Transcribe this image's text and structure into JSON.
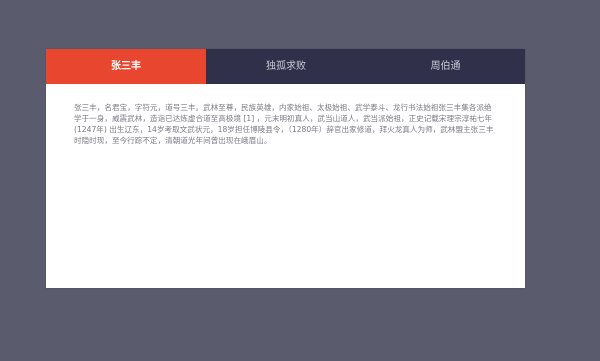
{
  "tabs": [
    {
      "label": "张三丰",
      "active": true
    },
    {
      "label": "独孤求败",
      "active": false
    },
    {
      "label": "周伯通",
      "active": false
    }
  ],
  "content": {
    "text": "张三丰，名君宝，字符元，道号三丰。武林至尊，民族英雄，内家始祖、太极始祖、武学泰斗、龙行书法始祖张三丰集各派绝学于一身，威震武林，造诣已达炼虚合道至高极境 [1] ，元末明初真人，武当山道人，武当派始祖，正史记载宋理宗淳祐七年(1247年) 出生辽东，14岁考取文武状元，18岁担任博陵县令，（1280年）辞官出家修道，拜火龙真人为师，武林盟主张三丰时隐时现，至今行踪不定，清朝道光年间曾出现在峨眉山。"
  },
  "colors": {
    "background": "#5b5b6e",
    "tab_bar": "#30304a",
    "active_tab": "#e8462f",
    "panel": "#ffffff",
    "text": "#7a7a86"
  }
}
